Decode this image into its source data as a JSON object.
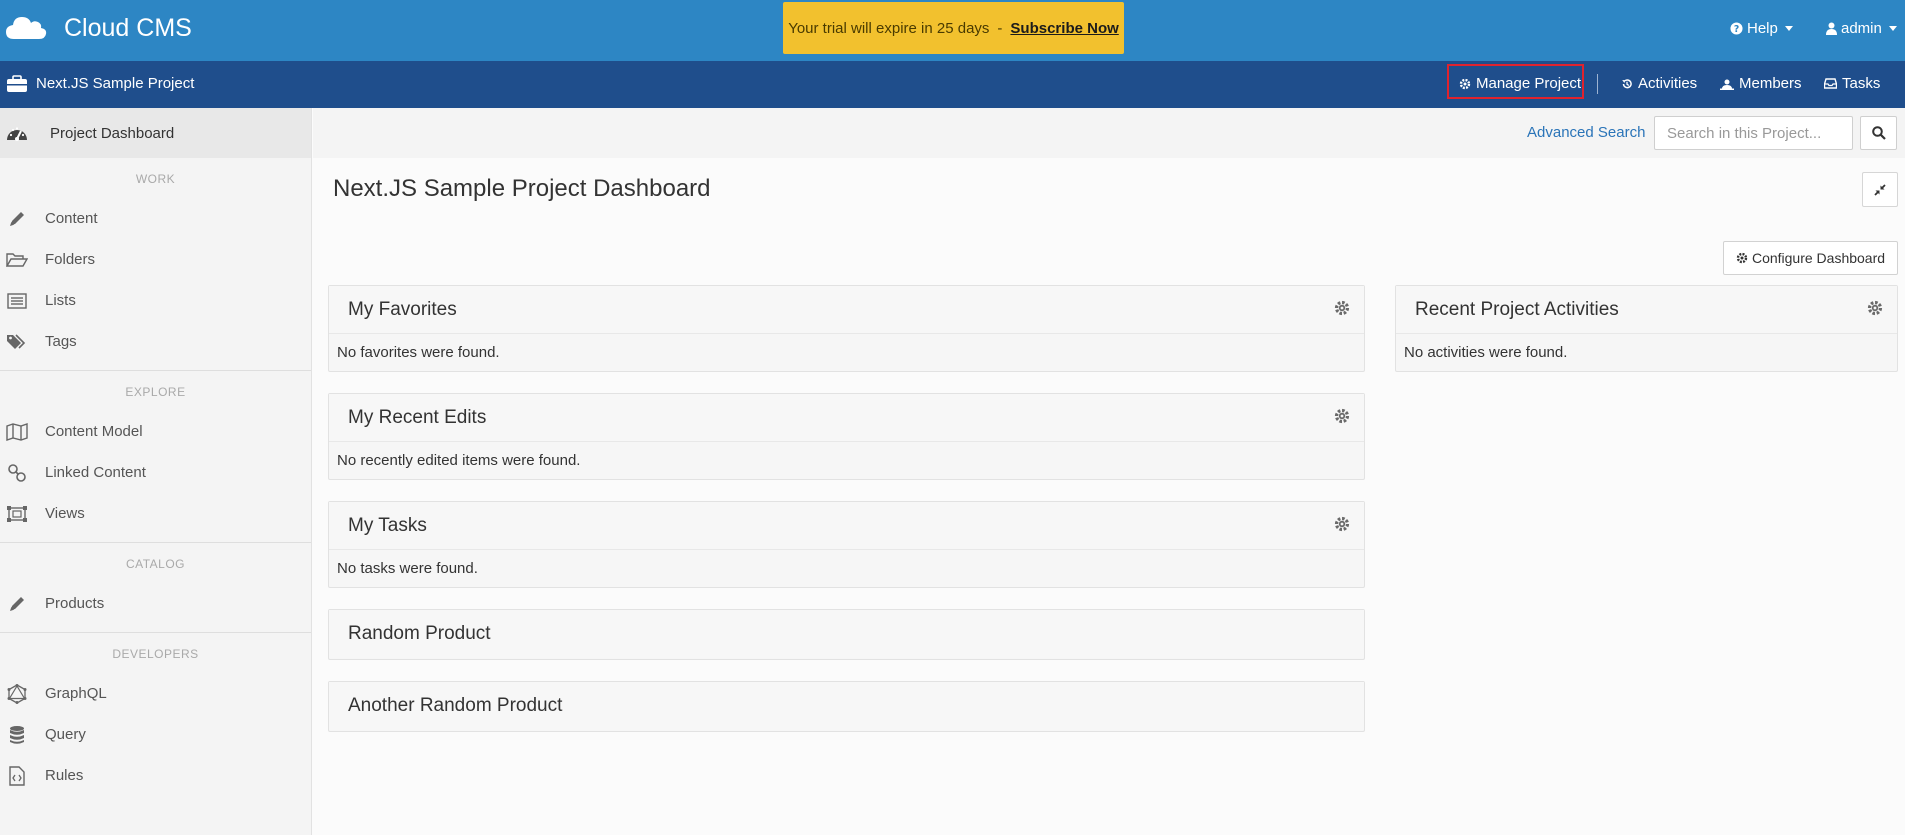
{
  "header": {
    "brand": "Cloud CMS",
    "trial_text": "Your trial will expire in 25 days",
    "trial_sep": "-",
    "subscribe_label": "Subscribe Now",
    "help_label": "Help",
    "user_label": "admin",
    "bg_color": "#2d86c4",
    "trial_color": "#f2c12e"
  },
  "project_bar": {
    "project_name": "Next.JS Sample Project",
    "manage_label": "Manage Project",
    "activities_label": "Activities",
    "members_label": "Members",
    "tasks_label": "Tasks",
    "bg_color": "#1f4e8c",
    "highlight_color": "#e0232e"
  },
  "sidebar": {
    "dashboard_label": "Project Dashboard",
    "sections": {
      "work": "WORK",
      "explore": "EXPLORE",
      "catalog": "CATALOG",
      "developers": "DEVELOPERS"
    },
    "items": {
      "content": "Content",
      "folders": "Folders",
      "lists": "Lists",
      "tags": "Tags",
      "content_model": "Content Model",
      "linked_content": "Linked Content",
      "views": "Views",
      "products": "Products",
      "graphql": "GraphQL",
      "query": "Query",
      "rules": "Rules"
    }
  },
  "search": {
    "advanced_label": "Advanced Search",
    "placeholder": "Search in this Project..."
  },
  "main": {
    "title": "Next.JS Sample Project Dashboard",
    "configure_label": "Configure Dashboard",
    "panels": {
      "favorites": {
        "title": "My Favorites",
        "empty": "No favorites were found."
      },
      "recent_edits": {
        "title": "My Recent Edits",
        "empty": "No recently edited items were found."
      },
      "tasks": {
        "title": "My Tasks",
        "empty": "No tasks were found."
      },
      "random_product": {
        "title": "Random Product"
      },
      "another_random_product": {
        "title": "Another Random Product"
      },
      "activities": {
        "title": "Recent Project Activities",
        "empty": "No activities were found."
      }
    }
  }
}
